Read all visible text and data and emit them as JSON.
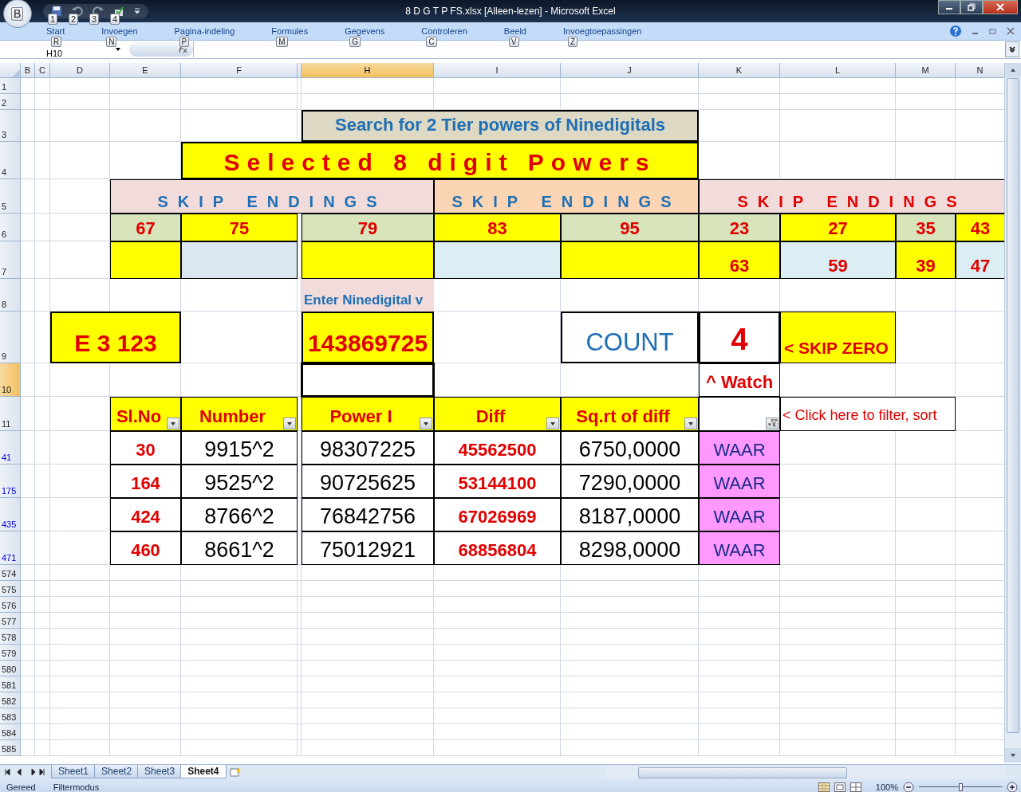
{
  "window": {
    "title": "8 D G T P FS.xlsx  [Alleen-lezen] - Microsoft Excel",
    "office_keytip": "B"
  },
  "quick_access": [
    {
      "kind": "save",
      "keytip": "1"
    },
    {
      "kind": "undo",
      "keytip": "2"
    },
    {
      "kind": "redo",
      "keytip": "3"
    },
    {
      "kind": "custom",
      "keytip": "4"
    }
  ],
  "ribbon_tabs": [
    {
      "label": "Start",
      "keytip": "R"
    },
    {
      "label": "Invoegen",
      "keytip": "N"
    },
    {
      "label": "Pagina-indeling",
      "keytip": "P"
    },
    {
      "label": "Formules",
      "keytip": "M"
    },
    {
      "label": "Gegevens",
      "keytip": "G"
    },
    {
      "label": "Controleren",
      "keytip": "C"
    },
    {
      "label": "Beeld",
      "keytip": "V"
    },
    {
      "label": "Invoegtoepassingen",
      "keytip": "Z"
    }
  ],
  "name_box": "H10",
  "columns": [
    {
      "label": "B",
      "selected": false
    },
    {
      "label": "C",
      "selected": false
    },
    {
      "label": "D",
      "selected": false
    },
    {
      "label": "E",
      "selected": false
    },
    {
      "label": "F",
      "selected": false
    },
    {
      "selected": false
    },
    {
      "label": "H",
      "selected": true
    },
    {
      "label": "I",
      "selected": false
    },
    {
      "label": "J",
      "selected": false
    },
    {
      "label": "K",
      "selected": false
    },
    {
      "label": "L",
      "selected": false
    },
    {
      "label": "M",
      "selected": false
    },
    {
      "label": "N",
      "selected": false
    }
  ],
  "rows": [
    {
      "label": "1",
      "filtered": false,
      "selected": false,
      "cells": []
    },
    {
      "label": "2",
      "filtered": false,
      "selected": false,
      "cells": []
    },
    {
      "label": "3",
      "filtered": false,
      "selected": false,
      "cells": [
        {
          "kind": "blank"
        },
        {
          "kind": "blank"
        },
        {
          "kind": "blank"
        },
        {
          "kind": "blank"
        },
        {
          "kind": "blank"
        },
        {
          "kind": "blank"
        },
        {
          "kind": "title",
          "color": "#ddd9c4",
          "outline": true,
          "text": "Search for 2 Tier powers of Ninedigitals"
        },
        {
          "kind": "merged"
        },
        {
          "kind": "merged"
        },
        {
          "kind": "blank"
        },
        {
          "kind": "blank"
        },
        {
          "kind": "blank"
        },
        {
          "kind": "blank"
        }
      ]
    },
    {
      "label": "4",
      "filtered": false,
      "selected": false,
      "cells": [
        {
          "kind": "blank"
        },
        {
          "kind": "blank"
        },
        {
          "kind": "blank"
        },
        {
          "kind": "blank"
        },
        {
          "kind": "banner",
          "color": "#ffff00",
          "outline": true,
          "text": "Selected 8 digit Powers"
        },
        {
          "kind": "merged"
        },
        {
          "kind": "merged"
        },
        {
          "kind": "merged"
        },
        {
          "kind": "merged"
        },
        {
          "kind": "blank"
        },
        {
          "kind": "blank"
        },
        {
          "kind": "blank"
        },
        {
          "kind": "blank"
        }
      ]
    },
    {
      "label": "5",
      "filtered": false,
      "selected": false,
      "cells": [
        {
          "kind": "blank"
        },
        {
          "kind": "blank"
        },
        {
          "kind": "blank"
        },
        {
          "kind": "skip-blue",
          "color": "#f2dcdb",
          "outline": true,
          "text": "SKIP ENDINGS"
        },
        {
          "kind": "merged"
        },
        {
          "kind": "merged"
        },
        {
          "kind": "merged"
        },
        {
          "kind": "skip-blue",
          "color": "#fcd5b4",
          "outline": true,
          "text": "SKIP ENDINGS"
        },
        {
          "kind": "merged"
        },
        {
          "kind": "skip-red",
          "color": "#f2dcdb",
          "outline": true,
          "text": "SKIP ENDINGS"
        },
        {
          "kind": "merged"
        },
        {
          "kind": "merged"
        },
        {
          "kind": "merged"
        }
      ]
    },
    {
      "label": "6",
      "filtered": false,
      "selected": false,
      "cells": [
        {
          "kind": "blank"
        },
        {
          "kind": "blank"
        },
        {
          "kind": "blank"
        },
        {
          "kind": "ending",
          "color": "#d8e4bc",
          "outline": true,
          "text": "67"
        },
        {
          "kind": "ending",
          "color": "#ffff00",
          "outline": true,
          "text": "75"
        },
        {
          "kind": "blank"
        },
        {
          "kind": "ending",
          "color": "#d8e4bc",
          "outline": true,
          "text": "79"
        },
        {
          "kind": "ending",
          "color": "#ffff00",
          "outline": true,
          "text": "83"
        },
        {
          "kind": "ending",
          "color": "#d8e4bc",
          "outline": true,
          "text": "95"
        },
        {
          "kind": "ending",
          "color": "#d8e4bc",
          "outline": true,
          "text": "23"
        },
        {
          "kind": "ending",
          "color": "#ffff00",
          "outline": true,
          "text": "27"
        },
        {
          "kind": "ending",
          "color": "#d8e4bc",
          "outline": true,
          "text": "35"
        },
        {
          "kind": "ending",
          "color": "#ffff00",
          "outline": true,
          "text": "43"
        }
      ]
    },
    {
      "label": "7",
      "filtered": false,
      "selected": false,
      "cells": [
        {
          "kind": "blank"
        },
        {
          "kind": "blank"
        },
        {
          "kind": "blank"
        },
        {
          "kind": "ending",
          "color": "#ffff00",
          "outline": true
        },
        {
          "kind": "ending",
          "color": "#dce6f1",
          "outline": true
        },
        {
          "kind": "blank"
        },
        {
          "kind": "ending",
          "color": "#ffff00",
          "outline": true
        },
        {
          "kind": "ending",
          "color": "#daeef3",
          "outline": true
        },
        {
          "kind": "ending",
          "color": "#ffff00",
          "outline": true
        },
        {
          "kind": "ending",
          "color": "#ffff00",
          "outline": true,
          "text": "63"
        },
        {
          "kind": "ending",
          "color": "#daeef3",
          "outline": true,
          "text": "59"
        },
        {
          "kind": "ending",
          "color": "#ffff00",
          "outline": true,
          "text": "39"
        },
        {
          "kind": "ending",
          "color": "#daeef3",
          "outline": true,
          "text": "47"
        }
      ]
    },
    {
      "label": "8",
      "filtered": false,
      "selected": false,
      "cells": [
        {
          "kind": "blank"
        },
        {
          "kind": "blank"
        },
        {
          "kind": "blank"
        },
        {
          "kind": "blank"
        },
        {
          "kind": "blank"
        },
        {
          "kind": "blank"
        },
        {
          "kind": "prompt",
          "color": "#f2dcdb",
          "outline": false,
          "text": "Enter Ninedigital v"
        },
        {
          "kind": "blank"
        },
        {
          "kind": "blank"
        },
        {
          "kind": "blank"
        },
        {
          "kind": "blank"
        },
        {
          "kind": "blank"
        },
        {
          "kind": "blank"
        }
      ]
    },
    {
      "label": "9",
      "filtered": false,
      "selected": false,
      "cells": [
        {
          "kind": "blank"
        },
        {
          "kind": "blank"
        },
        {
          "kind": "big-red",
          "color": "#ffff00",
          "outline": true,
          "text": "E 3 123"
        },
        {
          "kind": "merged"
        },
        {
          "kind": "blank"
        },
        {
          "kind": "blank"
        },
        {
          "kind": "big-red",
          "color": "#ffff00",
          "outline": true,
          "text": "143869725"
        },
        {
          "kind": "blank"
        },
        {
          "kind": "count",
          "color": "#ffffff",
          "outline": true,
          "text": "COUNT"
        },
        {
          "kind": "count-value",
          "color": "#ffffff",
          "outline": true,
          "text": "4"
        },
        {
          "kind": "skip-zero",
          "color": "#ffff00",
          "outline": true,
          "text": "< SKIP ZERO"
        },
        {
          "kind": "blank"
        },
        {
          "kind": "blank"
        }
      ]
    },
    {
      "label": "10",
      "filtered": false,
      "selected": true,
      "cells": [
        {
          "kind": "blank"
        },
        {
          "kind": "blank"
        },
        {
          "kind": "blank"
        },
        {
          "kind": "blank"
        },
        {
          "kind": "blank"
        },
        {
          "kind": "blank"
        },
        {
          "kind": "active",
          "color": "#ffffff",
          "outline": true
        },
        {
          "kind": "blank"
        },
        {
          "kind": "blank"
        },
        {
          "kind": "watch",
          "color": "#ffffff",
          "outline": true,
          "text": "^ Watch"
        },
        {
          "kind": "blank"
        },
        {
          "kind": "blank"
        },
        {
          "kind": "blank"
        }
      ]
    },
    {
      "label": "11",
      "filtered": false,
      "selected": false,
      "cells": [
        {
          "kind": "blank"
        },
        {
          "kind": "blank"
        },
        {
          "kind": "blank"
        },
        {
          "kind": "header",
          "color": "#ffff00",
          "outline": true,
          "filter_applied": false,
          "text": "Sl.No"
        },
        {
          "kind": "header",
          "color": "#ffff00",
          "outline": true,
          "filter_applied": false,
          "text": "Number"
        },
        {
          "kind": "blank"
        },
        {
          "kind": "header",
          "color": "#ffff00",
          "outline": true,
          "filter_applied": false,
          "text": "Power I"
        },
        {
          "kind": "header",
          "color": "#ffff00",
          "outline": true,
          "filter_applied": false,
          "text": "Diff"
        },
        {
          "kind": "header",
          "color": "#ffff00",
          "outline": true,
          "filter_applied": false,
          "text": "Sq.rt of diff"
        },
        {
          "kind": "header",
          "color": "#ffffff",
          "outline": true,
          "filter_applied": true
        },
        {
          "kind": "note",
          "color": "#ffffff",
          "outline": true,
          "text": "< Click here to filter, sort"
        },
        {
          "kind": "merged"
        },
        {
          "kind": "blank"
        }
      ]
    },
    {
      "label": "41",
      "filtered": true,
      "selected": false,
      "cells": [
        {
          "kind": "blank"
        },
        {
          "kind": "blank"
        },
        {
          "kind": "blank"
        },
        {
          "kind": "index",
          "color": "#ffffff",
          "outline": true,
          "text": "30"
        },
        {
          "kind": "value",
          "color": "#ffffff",
          "outline": true,
          "text": "9915^2"
        },
        {
          "kind": "blank"
        },
        {
          "kind": "value",
          "color": "#ffffff",
          "outline": true,
          "text": "98307225"
        },
        {
          "kind": "diff",
          "color": "#ffffff",
          "outline": true,
          "text": "45562500"
        },
        {
          "kind": "value",
          "color": "#ffffff",
          "outline": true,
          "text": "6750,0000"
        },
        {
          "kind": "flag",
          "color": "#ff99ff",
          "outline": true,
          "text": "WAAR"
        },
        {
          "kind": "blank"
        },
        {
          "kind": "blank"
        },
        {
          "kind": "blank"
        }
      ]
    },
    {
      "label": "175",
      "filtered": true,
      "selected": false,
      "cells": [
        {
          "kind": "blank"
        },
        {
          "kind": "blank"
        },
        {
          "kind": "blank"
        },
        {
          "kind": "index",
          "color": "#ffffff",
          "outline": true,
          "text": "164"
        },
        {
          "kind": "value",
          "color": "#ffffff",
          "outline": true,
          "text": "9525^2"
        },
        {
          "kind": "blank"
        },
        {
          "kind": "value",
          "color": "#ffffff",
          "outline": true,
          "text": "90725625"
        },
        {
          "kind": "diff",
          "color": "#ffffff",
          "outline": true,
          "text": "53144100"
        },
        {
          "kind": "value",
          "color": "#ffffff",
          "outline": true,
          "text": "7290,0000"
        },
        {
          "kind": "flag",
          "color": "#ff99ff",
          "outline": true,
          "text": "WAAR"
        },
        {
          "kind": "blank"
        },
        {
          "kind": "blank"
        },
        {
          "kind": "blank"
        }
      ]
    },
    {
      "label": "435",
      "filtered": true,
      "selected": false,
      "cells": [
        {
          "kind": "blank"
        },
        {
          "kind": "blank"
        },
        {
          "kind": "blank"
        },
        {
          "kind": "index",
          "color": "#ffffff",
          "outline": true,
          "text": "424"
        },
        {
          "kind": "value",
          "color": "#ffffff",
          "outline": true,
          "text": "8766^2"
        },
        {
          "kind": "blank"
        },
        {
          "kind": "value",
          "color": "#ffffff",
          "outline": true,
          "text": "76842756"
        },
        {
          "kind": "diff",
          "color": "#ffffff",
          "outline": true,
          "text": "67026969"
        },
        {
          "kind": "value",
          "color": "#ffffff",
          "outline": true,
          "text": "8187,0000"
        },
        {
          "kind": "flag",
          "color": "#ff99ff",
          "outline": true,
          "text": "WAAR"
        },
        {
          "kind": "blank"
        },
        {
          "kind": "blank"
        },
        {
          "kind": "blank"
        }
      ]
    },
    {
      "label": "471",
      "filtered": true,
      "selected": false,
      "cells": [
        {
          "kind": "blank"
        },
        {
          "kind": "blank"
        },
        {
          "kind": "blank"
        },
        {
          "kind": "index",
          "color": "#ffffff",
          "outline": true,
          "text": "460"
        },
        {
          "kind": "value",
          "color": "#ffffff",
          "outline": true,
          "text": "8661^2"
        },
        {
          "kind": "blank"
        },
        {
          "kind": "value",
          "color": "#ffffff",
          "outline": true,
          "text": "75012921"
        },
        {
          "kind": "diff",
          "color": "#ffffff",
          "outline": true,
          "text": "68856804"
        },
        {
          "kind": "value",
          "color": "#ffffff",
          "outline": true,
          "text": "8298,0000"
        },
        {
          "kind": "flag",
          "color": "#ff99ff",
          "outline": true,
          "text": "WAAR"
        },
        {
          "kind": "blank"
        },
        {
          "kind": "blank"
        },
        {
          "kind": "blank"
        }
      ]
    },
    {
      "label": "574",
      "filtered": false,
      "selected": false,
      "cells": []
    },
    {
      "label": "575",
      "filtered": false,
      "selected": false,
      "cells": []
    },
    {
      "label": "576",
      "filtered": false,
      "selected": false,
      "cells": []
    },
    {
      "label": "577",
      "filtered": false,
      "selected": false,
      "cells": []
    },
    {
      "label": "578",
      "filtered": false,
      "selected": false,
      "cells": []
    },
    {
      "label": "579",
      "filtered": false,
      "selected": false,
      "cells": []
    },
    {
      "label": "580",
      "filtered": false,
      "selected": false,
      "cells": []
    },
    {
      "label": "581",
      "filtered": false,
      "selected": false,
      "cells": []
    },
    {
      "label": "582",
      "filtered": false,
      "selected": false,
      "cells": []
    },
    {
      "label": "583",
      "filtered": false,
      "selected": false,
      "cells": []
    },
    {
      "label": "584",
      "filtered": false,
      "selected": false,
      "cells": []
    },
    {
      "label": "585",
      "filtered": false,
      "selected": false,
      "cells": []
    }
  ],
  "sheet_tabs": [
    {
      "label": "Sheet1",
      "selected": false
    },
    {
      "label": "Sheet2",
      "selected": false
    },
    {
      "label": "Sheet3",
      "selected": false
    },
    {
      "label": "Sheet4",
      "selected": true
    }
  ],
  "status_bar": {
    "items": [
      "Gereed",
      "Filtermodus"
    ],
    "zoom": "100%",
    "zoom_slider": {
      "level": 0.5
    }
  }
}
